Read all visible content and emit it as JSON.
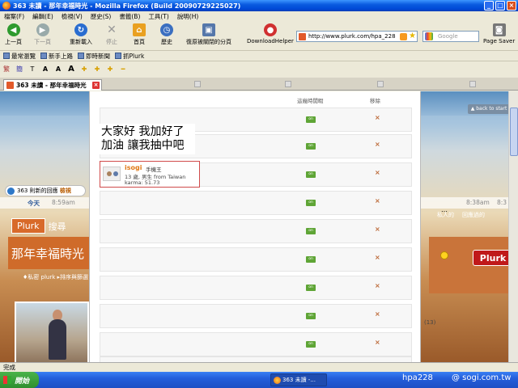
{
  "window": {
    "title": "363 未讀 - 那年幸福時光 - Mozilla Firefox (Build 2009072922502​7)",
    "minimize": "_",
    "maximize": "□",
    "close": "×"
  },
  "menu": [
    "檔案(F)",
    "編輯(E)",
    "檢視(V)",
    "歷史(S)",
    "書籤(B)",
    "工具(T)",
    "說明(H)"
  ],
  "nav": {
    "back": "上一頁",
    "forward": "下一頁",
    "reload": "重新載入",
    "stop": "停止",
    "home": "首頁",
    "history": "歷史",
    "restore": "復原被關閉的分頁",
    "download": "DownloadHelper",
    "url": "http://www.plurk.com/hpa_228",
    "search_placeholder": "Google",
    "page_saver": "Page Saver"
  },
  "bookmarks": [
    "最常瀏覽",
    "新手上路",
    "即時新聞",
    "抓Plurk"
  ],
  "format_bar": [
    "繁",
    "簡",
    "T",
    "A",
    "A",
    "A"
  ],
  "tab": {
    "title": "363 未讀 - 那年幸福時光"
  },
  "page": {
    "notification": "363 則新的回應",
    "notification_link": "檢視",
    "today": "今天",
    "time_left": "8:59am",
    "time_right1": "8:38am",
    "time_right2": "8:3",
    "plurk_logo": "Plurk",
    "search_tab": "搜尋",
    "hero_title": "那年幸福時光",
    "hero_sub": "♦私密 plurk ▸排序與篩選",
    "back_to_top": "▲ back to start",
    "right_label1": "私人的",
    "right_label2": "回應過的",
    "plurk_button": "Plurk",
    "right_count": "(13)"
  },
  "list": {
    "col_recent": "這幾時閒暇",
    "col_remove": "移除",
    "post_text_line1": "大家好 我加好了",
    "post_text_line2": "加油 讓我抽中吧",
    "user": {
      "name": "isogi",
      "nickname": "手機王",
      "info": "13 歲, 男生 from Taiwan",
      "karma": "karma: 51.73"
    },
    "on_label": "on",
    "remove_label": "×",
    "rows": 10
  },
  "statusbar": "完成",
  "taskbar": {
    "start": "開始",
    "task": "363 未讀 -...",
    "watermark1": "hpa228",
    "watermark2": "@ sogi.com.tw"
  }
}
